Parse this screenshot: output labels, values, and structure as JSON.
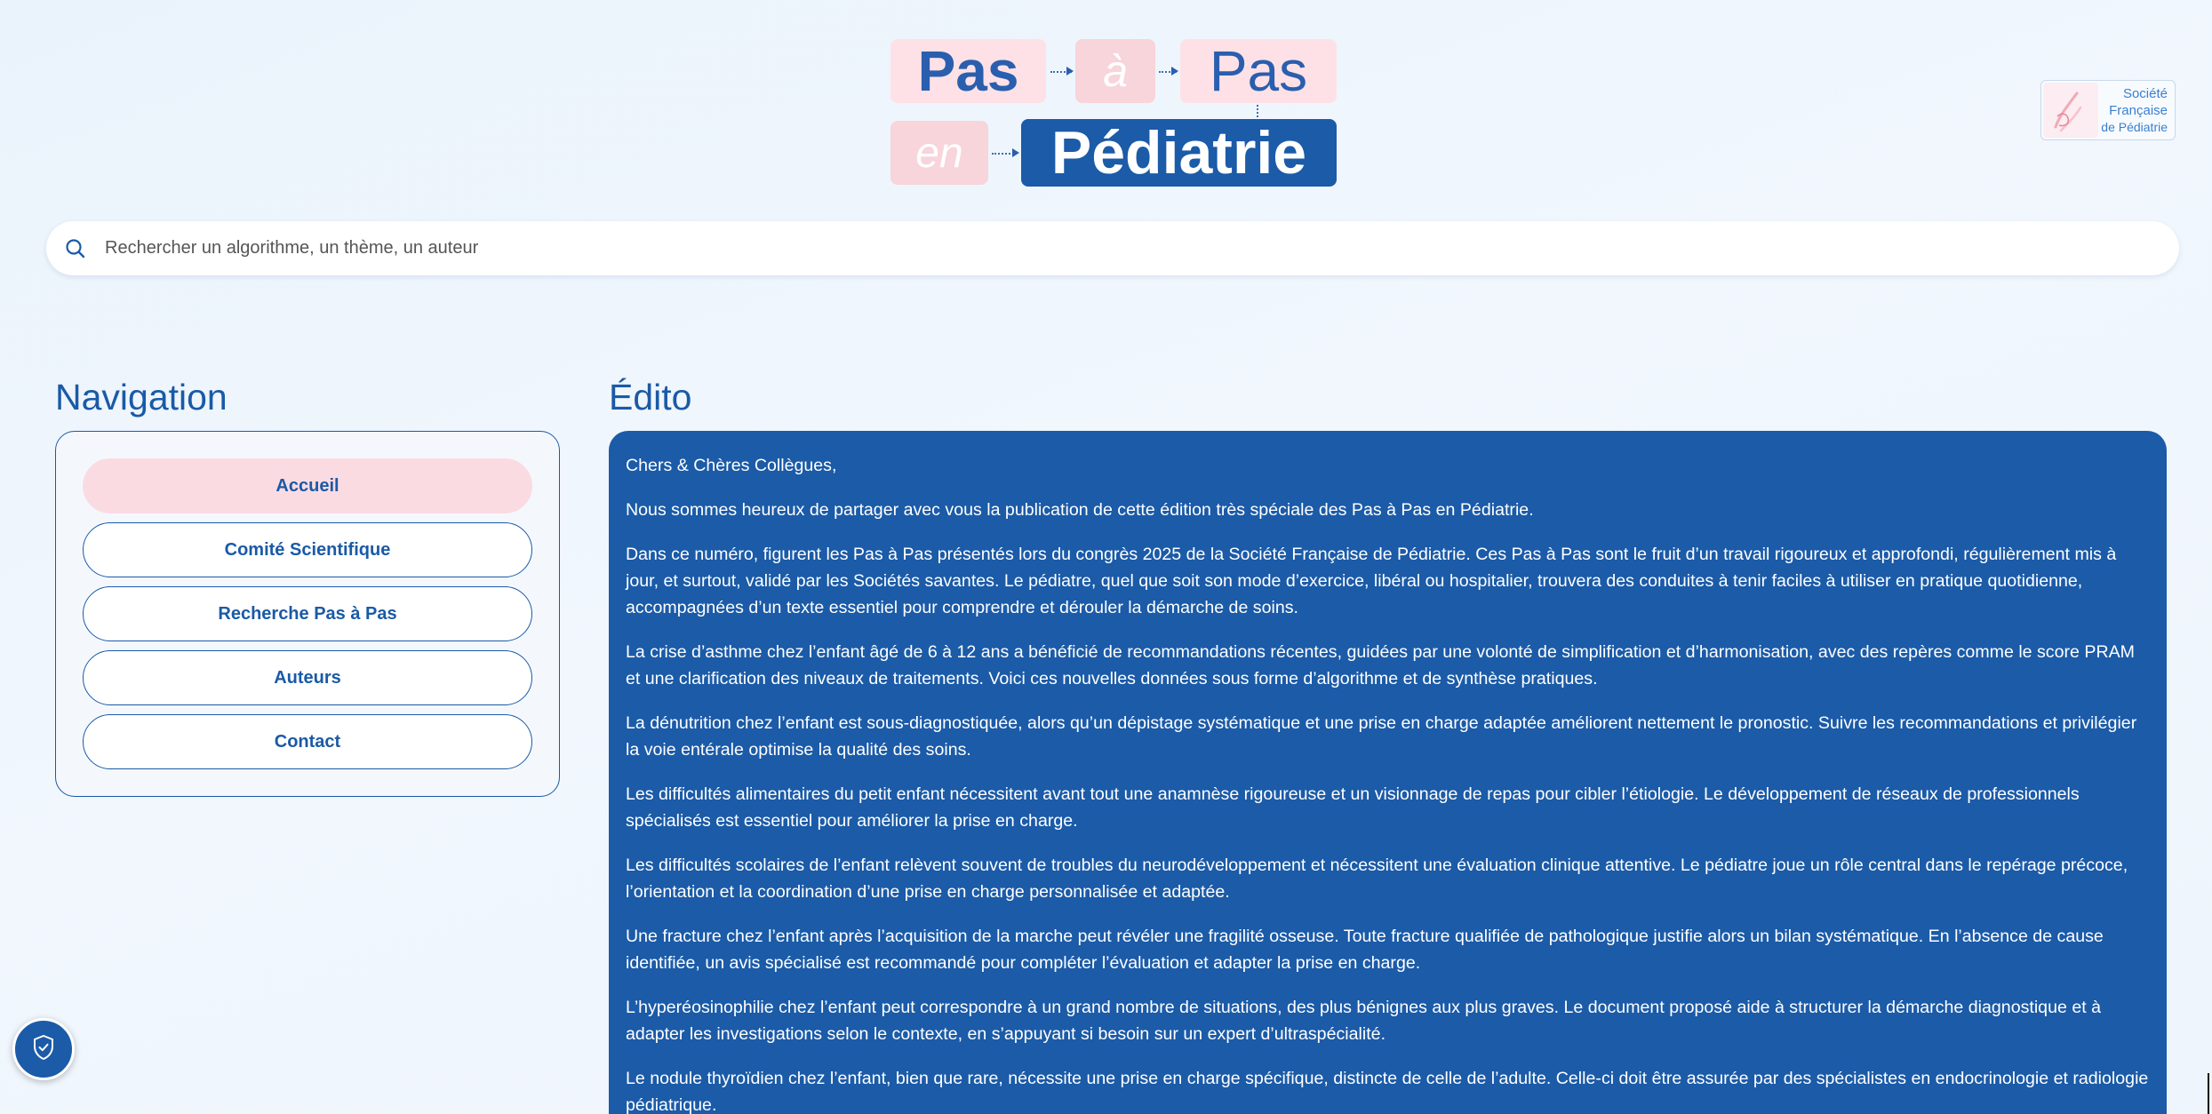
{
  "logo": {
    "word1": "Pas",
    "word2": "à",
    "word3": "Pas",
    "word4": "en",
    "word5": "Pédiatrie"
  },
  "sfp": {
    "line1": "Société",
    "line2": "Française",
    "line3": "de Pédiatrie"
  },
  "search": {
    "placeholder": "Rechercher un algorithme, un thème, un auteur"
  },
  "navigation": {
    "title": "Navigation",
    "items": [
      {
        "label": "Accueil",
        "active": true
      },
      {
        "label": "Comité Scientifique",
        "active": false
      },
      {
        "label": "Recherche Pas à Pas",
        "active": false
      },
      {
        "label": "Auteurs",
        "active": false
      },
      {
        "label": "Contact",
        "active": false
      }
    ]
  },
  "edito": {
    "title": "Édito",
    "paragraphs": [
      "Chers & Chères Collègues,",
      "Nous sommes heureux de partager avec vous la publication de cette édition très spéciale des Pas à Pas en Pédiatrie.",
      "Dans ce numéro, figurent les Pas à Pas présentés lors du congrès 2025 de la Société Française de Pédiatrie. Ces Pas à Pas sont le fruit d’un travail rigoureux et approfondi, régulièrement mis à jour, et surtout, validé par les Sociétés savantes. Le pédiatre, quel que soit son mode d’exercice, libéral ou hospitalier, trouvera des conduites à tenir faciles à utiliser en pratique quotidienne, accompagnées d’un texte essentiel pour comprendre et dérouler la démarche de soins.",
      "La crise d’asthme chez l’enfant âgé de 6 à 12 ans a bénéficié de recommandations récentes, guidées par une volonté de simplification et d’harmonisation, avec des repères comme le score PRAM et une clarification des niveaux de traitements. Voici ces nouvelles données sous forme d’algorithme et de synthèse pratiques.",
      "La dénutrition chez l’enfant est sous-diagnostiquée, alors qu’un dépistage systématique et une prise en charge adaptée améliorent nettement le pronostic. Suivre les recommandations et privilégier la voie entérale optimise la qualité des soins.",
      "Les difficultés alimentaires du petit enfant nécessitent avant tout une anamnèse rigoureuse et un visionnage de repas pour cibler l’étiologie. Le développement de réseaux de professionnels spécialisés est essentiel pour améliorer la prise en charge.",
      "Les difficultés scolaires de l’enfant relèvent souvent de troubles du neurodéveloppement et nécessitent une évaluation clinique attentive. Le pédiatre joue un rôle central dans le repérage précoce, l’orientation et la coordination d’une prise en charge personnalisée et adaptée.",
      "Une fracture chez l’enfant après l’acquisition de la marche peut révéler une fragilité osseuse. Toute fracture qualifiée de pathologique justifie alors un bilan systématique. En l’absence de cause identifiée, un avis spécialisé est recommandé pour compléter l’évaluation et adapter la prise en charge.",
      "L’hyperéosinophilie chez l’enfant peut correspondre à un grand nombre de situations, des plus bénignes aux plus graves. Le document proposé aide à structurer la démarche diagnostique et à adapter les investigations selon le contexte, en s’appuyant si besoin sur un expert d’ultraspécialité.",
      "Le nodule thyroïdien chez l’enfant, bien que rare, nécessite une prise en charge spécifique, distincte de celle de l’adulte. Celle-ci doit être assurée par des spécialistes en endocrinologie et radiologie pédiatrique."
    ]
  },
  "icons": {
    "search": "search-icon",
    "shield": "shield-check-icon"
  },
  "colors": {
    "brand_blue": "#1b5ba8",
    "accent_pink": "#fbdbe2",
    "background": "#eef5fc"
  }
}
